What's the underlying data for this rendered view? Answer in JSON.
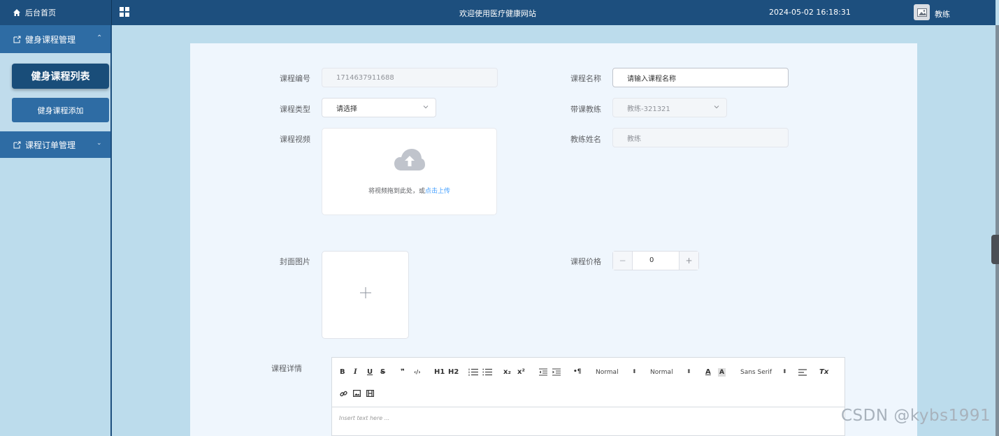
{
  "topbar": {
    "home_label": "后台首页",
    "site_title": "欢迎使用医疗健康网站",
    "datetime": "2024-05-02 16:18:31",
    "username": "教练"
  },
  "sidebar": {
    "groups": [
      {
        "label": "健身课程管理",
        "expanded": true,
        "items": [
          {
            "label": "健身课程列表",
            "active": true
          },
          {
            "label": "健身课程添加",
            "active": false
          }
        ]
      },
      {
        "label": "课程订单管理",
        "expanded": false
      }
    ]
  },
  "form": {
    "course_no": {
      "label": "课程编号",
      "value": "1714637911688"
    },
    "course_name": {
      "label": "课程名称",
      "placeholder": "请输入课程名称"
    },
    "course_type": {
      "label": "课程类型",
      "value": "请选择"
    },
    "coach": {
      "label": "带课教练",
      "value": "教练-321321"
    },
    "video": {
      "label": "课程视频",
      "hint": "将视频拖到此处，或",
      "link": "点击上传"
    },
    "coach_name": {
      "label": "教练姓名",
      "value": "教练"
    },
    "cover": {
      "label": "封面图片"
    },
    "price": {
      "label": "课程价格",
      "value": "0",
      "minus": "−",
      "plus": "+"
    },
    "detail": {
      "label": "课程详情"
    }
  },
  "editor": {
    "toolbar": [
      "B",
      "I",
      "U",
      "S",
      "❞",
      "‹/›",
      "H1",
      "H2",
      "ol",
      "ul",
      "x₂",
      "x²",
      "outdent",
      "indent",
      "¶",
      "Normal",
      "Normal",
      "A",
      "A-bg",
      "Sans Serif",
      "align",
      "Tx",
      "link",
      "image",
      "video"
    ],
    "size_label": "Normal",
    "header_label": "Normal",
    "font_label": "Sans Serif",
    "placeholder": "Insert text here ..."
  },
  "watermark": "CSDN @kybs1991",
  "colors": {
    "topbar": "#1d4f7e",
    "menu": "#2e6ca4",
    "active_item": "#194d79",
    "link": "#409eff",
    "background": "#bcdcec"
  }
}
